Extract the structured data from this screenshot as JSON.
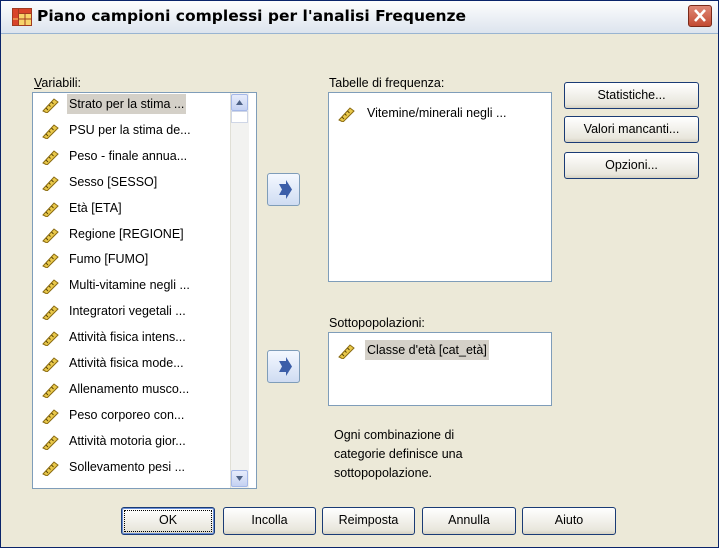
{
  "window": {
    "title": "Piano campioni complessi per l'analisi Frequenze"
  },
  "variables": {
    "label": "Variabili:",
    "items": [
      "Strato per la stima ...",
      "PSU per la stima de...",
      "Peso - finale annua...",
      "Sesso [SESSO]",
      "Età [ETA]",
      "Regione [REGIONE]",
      "Fumo [FUMO]",
      "Multi-vitamine negli ...",
      "Integratori vegetali ...",
      "Attività fisica intens...",
      "Attività fisica mode...",
      "Allenamento musco...",
      "Peso corporeo con...",
      "Attività motoria gior...",
      "Sollevamento pesi ..."
    ]
  },
  "frequency_tables": {
    "label": "Tabelle di frequenza:",
    "items": [
      "Vitemine/minerali negli ..."
    ]
  },
  "subpopulations": {
    "label": "Sottopopolazioni:",
    "items": [
      "Classe d'età [cat_età]"
    ]
  },
  "note": {
    "lines": [
      "Ogni combinazione di",
      "categorie definisce una",
      "sottopopolazione."
    ]
  },
  "side_buttons": {
    "statistics": "Statistiche...",
    "missing_values": "Valori mancanti...",
    "options": "Opzioni..."
  },
  "bottom_buttons": {
    "ok": "OK",
    "paste": "Incolla",
    "reset": "Reimposta",
    "cancel": "Annulla",
    "help": "Aiuto"
  },
  "colors": {
    "title_bar": "#dde4ee",
    "dialog_bg": "#ece9d8",
    "close_button": "#c34a32"
  },
  "icons": {
    "title": "pivot-table-icon",
    "variable": "ruler-icon",
    "move": "move-arrow-icon",
    "close": "close-icon"
  }
}
